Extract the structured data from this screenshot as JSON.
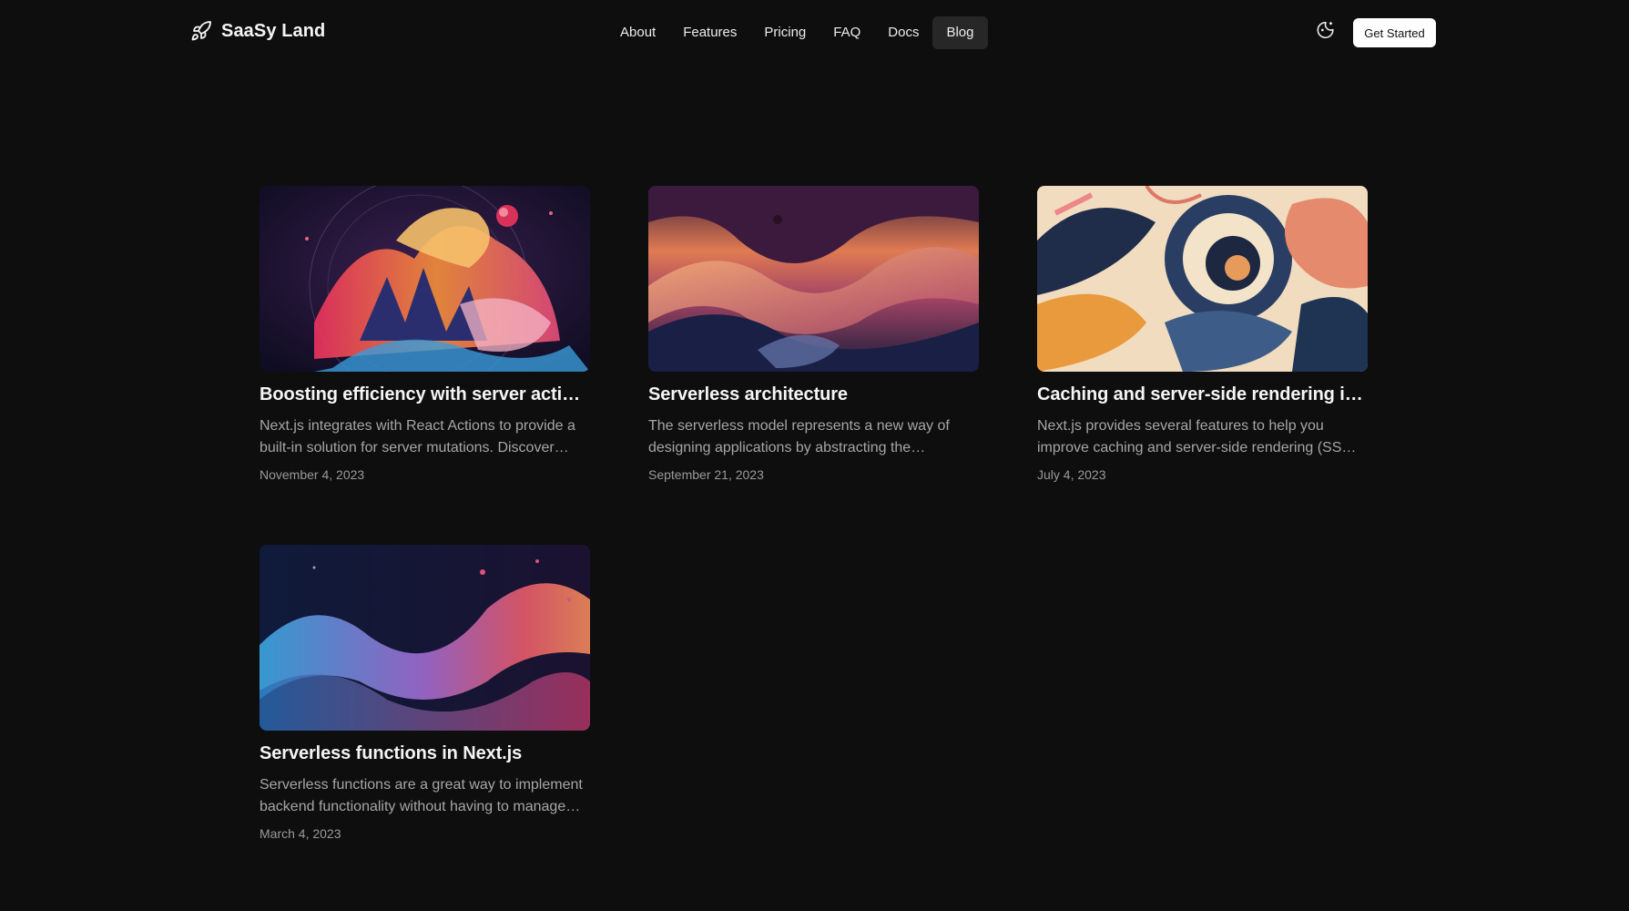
{
  "header": {
    "brand": "SaaSy Land",
    "nav": [
      {
        "label": "About",
        "active": false
      },
      {
        "label": "Features",
        "active": false
      },
      {
        "label": "Pricing",
        "active": false
      },
      {
        "label": "FAQ",
        "active": false
      },
      {
        "label": "Docs",
        "active": false
      },
      {
        "label": "Blog",
        "active": true
      }
    ],
    "cta": "Get Started"
  },
  "posts": [
    {
      "title": "Boosting efficiency with server actions",
      "excerpt": "Next.js integrates with React Actions to provide a built-in solution for server mutations. Discover…",
      "date": "November 4, 2023"
    },
    {
      "title": "Serverless architecture",
      "excerpt": "The serverless model represents a new way of designing applications by abstracting the…",
      "date": "September 21, 2023"
    },
    {
      "title": "Caching and server-side rendering in…",
      "excerpt": "Next.js provides several features to help you improve caching and server-side rendering (SS…",
      "date": "July 4, 2023"
    },
    {
      "title": "Serverless functions in Next.js",
      "excerpt": "Serverless functions are a great way to implement backend functionality without having to manage…",
      "date": "March 4, 2023"
    }
  ]
}
